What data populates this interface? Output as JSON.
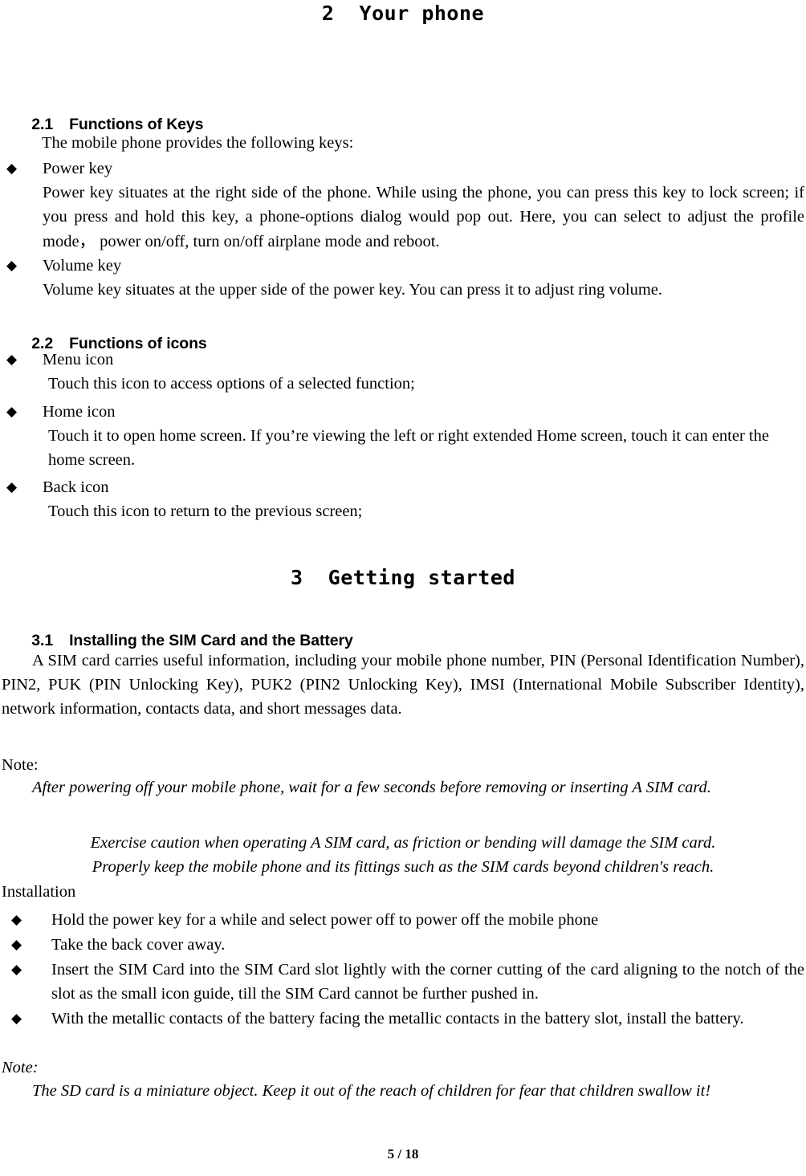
{
  "document": {
    "footer": "5 / 18"
  },
  "chapters": [
    {
      "id": "ch2",
      "label": "2  Your phone"
    },
    {
      "id": "ch3",
      "label": "3  Getting started"
    }
  ],
  "sections": {
    "s21": {
      "number": "2.1",
      "title": "Functions of Keys"
    },
    "s22": {
      "number": "2.2",
      "title": "Functions of icons"
    },
    "s31": {
      "number": "3.1",
      "title": "Installing the SIM Card and the Battery"
    }
  },
  "keys": {
    "intro": "The mobile phone provides the following keys:",
    "bullet_marker": "◆",
    "items": [
      {
        "title": "Power key",
        "desc": "Power key situates at the right side of the phone. While using the phone, you can press this key to lock screen; if you press and hold this key, a phone-options dialog would pop out. Here, you can select to adjust the profile mode， power on/off, turn on/off airplane mode and reboot."
      },
      {
        "title": "Volume key",
        "desc": "Volume key situates at the upper side of the power key. You can press it to adjust ring volume."
      }
    ]
  },
  "icons": {
    "bullet_marker": "◆",
    "items": [
      {
        "title": "Menu icon",
        "desc": "Touch this icon to access options of a selected function;"
      },
      {
        "title": "Home icon",
        "desc": "Touch it to open home screen. If you’re viewing the left or right extended Home screen, touch it can enter the home screen."
      },
      {
        "title": "Back icon",
        "desc": "Touch this icon to return to the previous screen;"
      }
    ]
  },
  "getting_started": {
    "sim_paragraph": "A SIM card carries useful information, including your mobile phone number, PIN (Personal Identification Number), PIN2, PUK (PIN Unlocking Key), PUK2 (PIN2 Unlocking Key), IMSI (International Mobile Subscriber Identity), network information, contacts data, and short messages data.",
    "note1_label": "Note:",
    "note1_lines": [
      "After powering off your mobile phone, wait for a few seconds before removing or inserting A SIM card.",
      "Exercise caution when operating A SIM card, as friction or bending will damage the SIM card.",
      "Properly keep the mobile phone and its fittings such as the SIM cards beyond children's reach."
    ],
    "installation_label": "Installation",
    "bullet_marker": "◆",
    "installation_steps": [
      "Hold the power key for a while and select power off to power off the mobile phone",
      "Take the back cover away.",
      "Insert the SIM Card into the SIM Card slot lightly with the corner cutting of the card aligning to the notch of the slot as the small icon guide, till the SIM Card cannot be further pushed in.",
      "With the metallic contacts of the battery facing the metallic contacts in the battery slot, install the battery."
    ],
    "note2_label": "Note:",
    "note2_body": "The SD card is a miniature object. Keep it out of the reach of children for fear that children swallow it!"
  }
}
